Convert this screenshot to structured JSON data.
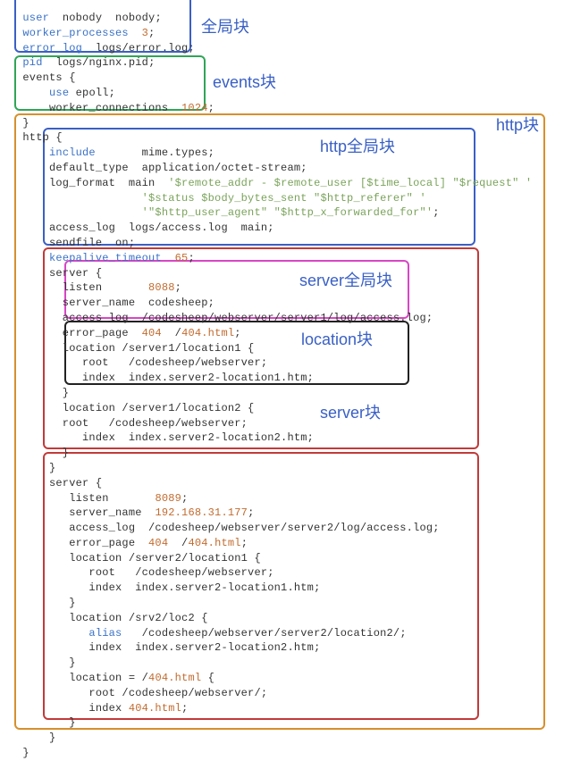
{
  "labels": {
    "global": "全局块",
    "events": "events块",
    "http": "http块",
    "http_global": "http全局块",
    "server_global": "server全局块",
    "location": "location块",
    "server": "server块"
  },
  "config": {
    "global_block": {
      "user": "nobody  nobody",
      "worker_processes": "3",
      "error_log": "logs/error.log",
      "pid": "logs/nginx.pid"
    },
    "events_block": {
      "use": "epoll",
      "worker_connections": "1024"
    },
    "http_block": {
      "include": "mime.types",
      "default_type": "application/octet-stream",
      "log_format_name": "main",
      "log_format_line1": "'$remote_addr - $remote_user [$time_local] \"$request\" '",
      "log_format_line2": "'$status $body_bytes_sent \"$http_referer\" '",
      "log_format_line3": "'\"$http_user_agent\" \"$http_x_forwarded_for\"'",
      "access_log": "logs/access.log  main",
      "sendfile": "on",
      "keepalive_timeout": "65",
      "servers": [
        {
          "listen": "8088",
          "server_name": "codesheep",
          "access_log": "/codesheep/webserver/server1/log/access.log",
          "error_page_code": "404",
          "error_page_path": "404.html",
          "locations": [
            {
              "match": "/server1/location1",
              "root": "/codesheep/webserver",
              "index": "index.server2-location1.htm"
            },
            {
              "match": "/server1/location2",
              "root": "/codesheep/webserver",
              "index": "index.server2-location2.htm"
            }
          ]
        },
        {
          "listen": "8089",
          "server_name_ip": "192.168.31.177",
          "access_log": "/codesheep/webserver/server2/log/access.log",
          "error_page_code": "404",
          "error_page_path": "404.html",
          "locations": [
            {
              "match": "/server2/location1",
              "root": "/codesheep/webserver",
              "index": "index.server2-location1.htm"
            },
            {
              "match": "/srv2/loc2",
              "alias": "/codesheep/webserver/server2/location2/",
              "index": "index.server2-location2.htm"
            },
            {
              "match": "= /404.html",
              "root": "/codesheep/webserver/",
              "index": "404.html"
            }
          ]
        }
      ]
    }
  }
}
